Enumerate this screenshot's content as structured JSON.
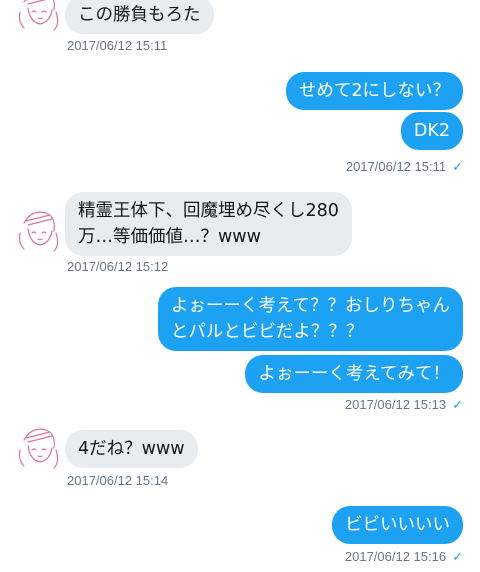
{
  "messages": [
    {
      "dir": "in",
      "lines": [
        "この勝負もろた"
      ],
      "time": "2017/06/12 15:11"
    },
    {
      "dir": "out",
      "lines": [
        "せめて2にしない？"
      ]
    },
    {
      "dir": "out",
      "lines": [
        "DK2"
      ],
      "time": "2017/06/12 15:11",
      "read": "✓"
    },
    {
      "dir": "in",
      "lines": [
        "精霊王体下、回魔埋め尽くし280",
        "万…等価価値…？www"
      ],
      "time": "2017/06/12 15:12"
    },
    {
      "dir": "out",
      "lines": [
        "よぉーーく考えて？？おしりちゃん",
        "とパルとビビだよ？？？"
      ]
    },
    {
      "dir": "out",
      "lines": [
        "よぉーーく考えてみて！"
      ],
      "time": "2017/06/12 15:13",
      "read": "✓"
    },
    {
      "dir": "in",
      "lines": [
        "4だね？www"
      ],
      "time": "2017/06/12 15:14"
    },
    {
      "dir": "out",
      "lines": [
        "ビビいいいい"
      ],
      "time": "2017/06/12 15:16",
      "read": "✓"
    }
  ],
  "colors": {
    "outgoing": "#1da1f2",
    "incoming": "#e6ecf0",
    "timestamp": "#657786"
  }
}
